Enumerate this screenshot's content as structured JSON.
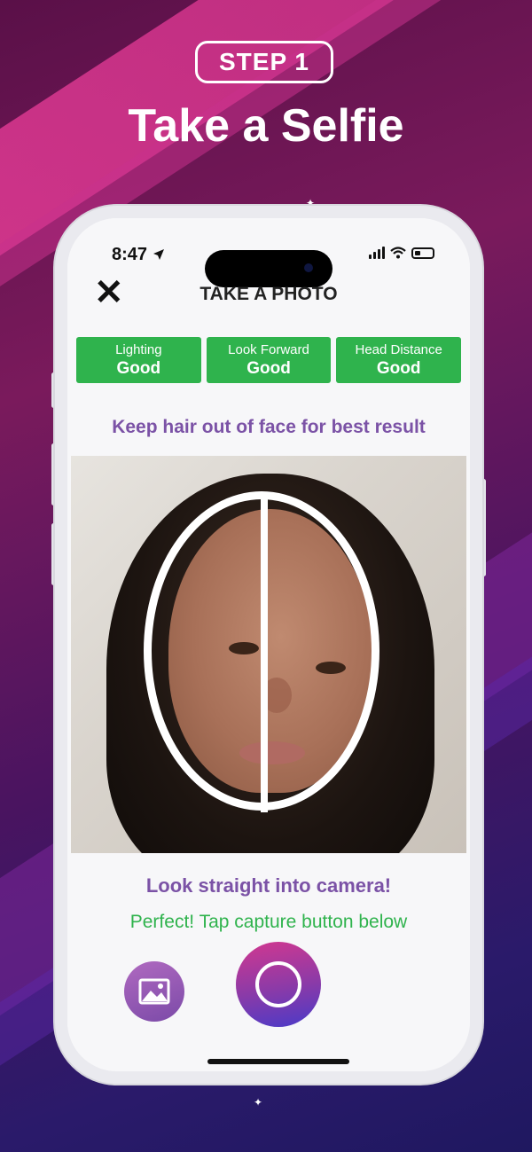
{
  "promo": {
    "step_label": "STEP 1",
    "headline": "Take a Selfie"
  },
  "status_bar": {
    "time": "8:47"
  },
  "header": {
    "close_label": "✕",
    "title": "TAKE A PHOTO"
  },
  "checks": [
    {
      "label": "Lighting",
      "value": "Good"
    },
    {
      "label": "Look Forward",
      "value": "Good"
    },
    {
      "label": "Head Distance",
      "value": "Good"
    }
  ],
  "hints": {
    "top": "Keep hair out of face for best result",
    "middle": "Look straight into camera!",
    "status": "Perfect! Tap capture button below"
  },
  "controls": {
    "gallery_icon": "image-gallery-icon",
    "capture_icon": "capture-shutter-icon"
  },
  "colors": {
    "good_green": "#2fb34d",
    "accent_purple": "#7b52a6"
  }
}
